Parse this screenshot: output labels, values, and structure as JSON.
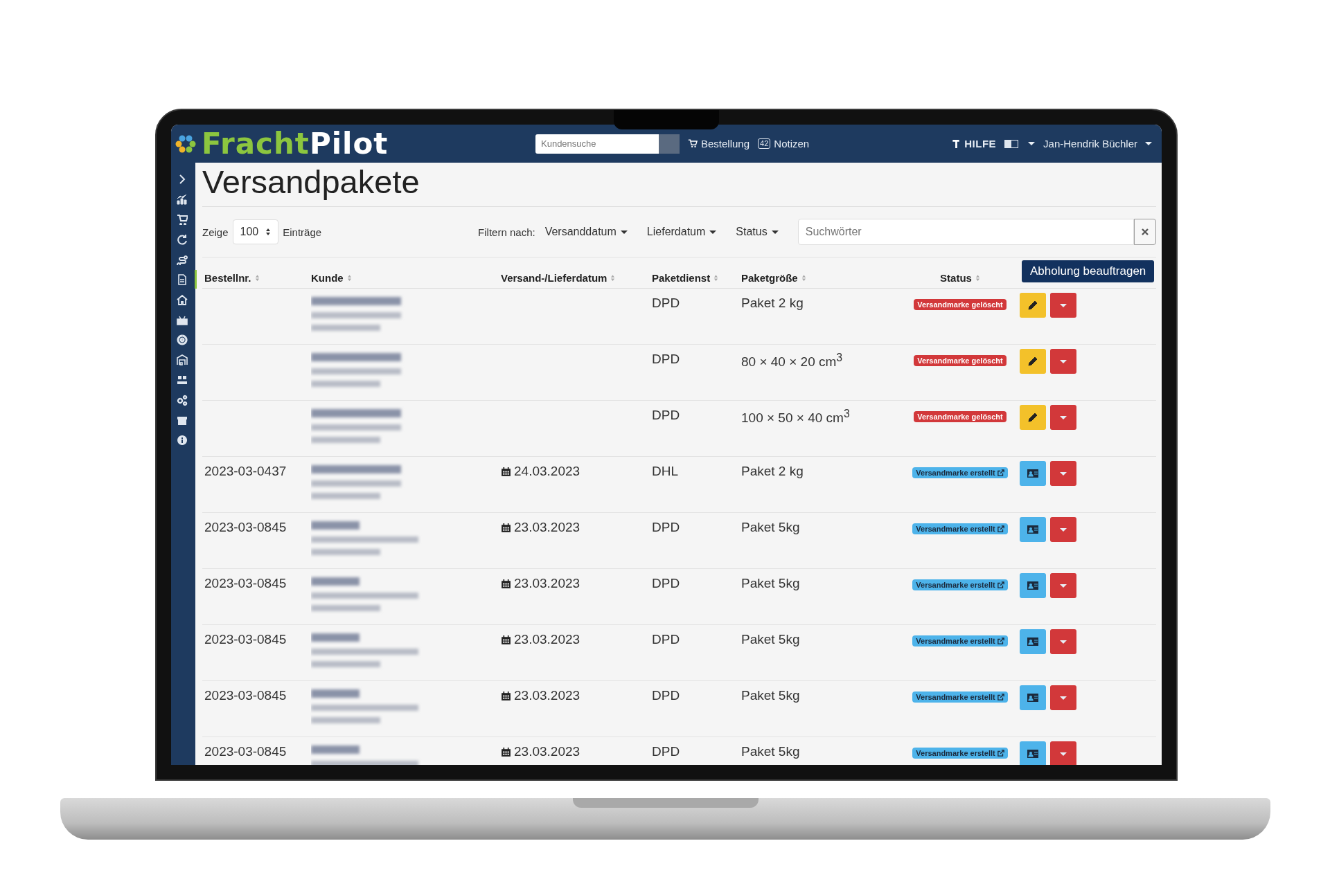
{
  "brand": {
    "first": "Fracht",
    "second": "Pilot"
  },
  "header": {
    "search_placeholder": "Kundensuche",
    "order_link": "Bestellung",
    "notes_count": "42",
    "notes_link": "Notizen",
    "help": "HILFE",
    "user": "Jan-Hendrik Büchler"
  },
  "sidebar": {
    "items": [
      {
        "selected": false
      },
      {
        "selected": false
      },
      {
        "selected": false
      },
      {
        "selected": false
      },
      {
        "selected": false
      },
      {
        "selected": true
      },
      {
        "selected": false
      },
      {
        "selected": false
      },
      {
        "selected": false
      },
      {
        "selected": false
      },
      {
        "selected": false
      },
      {
        "selected": false
      },
      {
        "selected": false
      },
      {
        "selected": false
      }
    ]
  },
  "page_title": "Versandpakete",
  "filters": {
    "show_label": "Zeige",
    "page_size": "100",
    "entries_label": "Einträge",
    "filter_label": "Filtern nach:",
    "dropdowns": [
      "Versanddatum",
      "Lieferdatum",
      "Status"
    ],
    "search_placeholder": "Suchwörter"
  },
  "table": {
    "columns": [
      "Bestellnr.",
      "Kunde",
      "Versand-/Lieferdatum",
      "Paketdienst",
      "Paketgröße",
      "Status"
    ],
    "action_button": "Abholung beauftragen",
    "rows": [
      {
        "order": "",
        "date": "",
        "service": "DPD",
        "size": "Paket 2 kg",
        "status": {
          "kind": "deleted",
          "label": "Versandmarke gelöscht"
        }
      },
      {
        "order": "",
        "date": "",
        "service": "DPD",
        "size": "80 × 40 × 20 cm$^{3}$",
        "status": {
          "kind": "deleted",
          "label": "Versandmarke gelöscht"
        }
      },
      {
        "order": "",
        "date": "",
        "service": "DPD",
        "size": "100 × 50 × 40 cm$^{3}$",
        "status": {
          "kind": "deleted",
          "label": "Versandmarke gelöscht"
        }
      },
      {
        "order": "2023-03-0437",
        "date": "24.03.2023",
        "service": "DHL",
        "size": "Paket 2 kg",
        "status": {
          "kind": "created",
          "label": "Versandmarke erstellt"
        }
      },
      {
        "order": "2023-03-0845",
        "date": "23.03.2023",
        "service": "DPD",
        "size": "Paket 5kg",
        "status": {
          "kind": "created",
          "label": "Versandmarke erstellt"
        }
      },
      {
        "order": "2023-03-0845",
        "date": "23.03.2023",
        "service": "DPD",
        "size": "Paket 5kg",
        "status": {
          "kind": "created",
          "label": "Versandmarke erstellt"
        }
      },
      {
        "order": "2023-03-0845",
        "date": "23.03.2023",
        "service": "DPD",
        "size": "Paket 5kg",
        "status": {
          "kind": "created",
          "label": "Versandmarke erstellt"
        }
      },
      {
        "order": "2023-03-0845",
        "date": "23.03.2023",
        "service": "DPD",
        "size": "Paket 5kg",
        "status": {
          "kind": "created",
          "label": "Versandmarke erstellt"
        }
      },
      {
        "order": "2023-03-0845",
        "date": "23.03.2023",
        "service": "DPD",
        "size": "Paket 5kg",
        "status": {
          "kind": "created",
          "label": "Versandmarke erstellt"
        }
      }
    ]
  }
}
